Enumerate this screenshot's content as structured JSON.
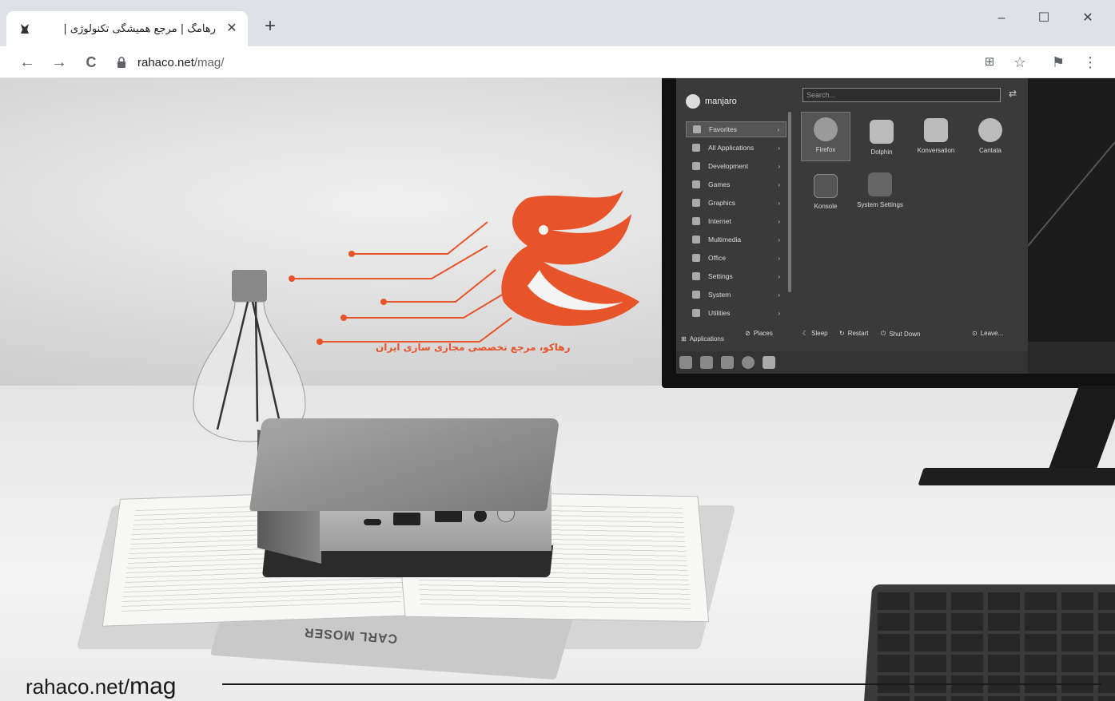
{
  "browser": {
    "tab": {
      "favicon": "rahaco-favicon",
      "title": "رهامگ | مرجع همیشگی تکنولوژی |",
      "close_label": "✕"
    },
    "new_tab_label": "+",
    "window_controls": {
      "minimize": "–",
      "maximize": "☐",
      "close": "✕"
    },
    "nav": {
      "back": "←",
      "forward": "→",
      "reload": "C"
    },
    "address": {
      "host": "rahaco.net",
      "path": "/mag/"
    },
    "toolbar_icons": {
      "translate": "⊞",
      "bookmark": "☆",
      "profile": "⚑",
      "menu": "⋮"
    }
  },
  "hero": {
    "watermark_prefix": "rahaco.net/",
    "watermark_suffix": "mag",
    "logo_caption": "رهاکو، مرجع تخصصی مجازی سازی ایران",
    "book_spine": "CARL MOSER"
  },
  "kde_menu": {
    "user": "manjaro",
    "search_placeholder": "Search...",
    "categories": [
      "Favorites",
      "All Applications",
      "Development",
      "Games",
      "Graphics",
      "Internet",
      "Multimedia",
      "Office",
      "Settings",
      "System",
      "Utilities"
    ],
    "apps": [
      "Firefox",
      "Dolphin",
      "Konversation",
      "Cantata",
      "Konsole",
      "System Settings"
    ],
    "bottom": {
      "applications": "Applications",
      "places": "Places",
      "sleep": "Sleep",
      "restart": "Restart",
      "shutdown": "Shut Down",
      "leave": "Leave..."
    }
  },
  "colors": {
    "brand_orange": "#e8542a",
    "chrome_bg": "#dee1e6"
  }
}
